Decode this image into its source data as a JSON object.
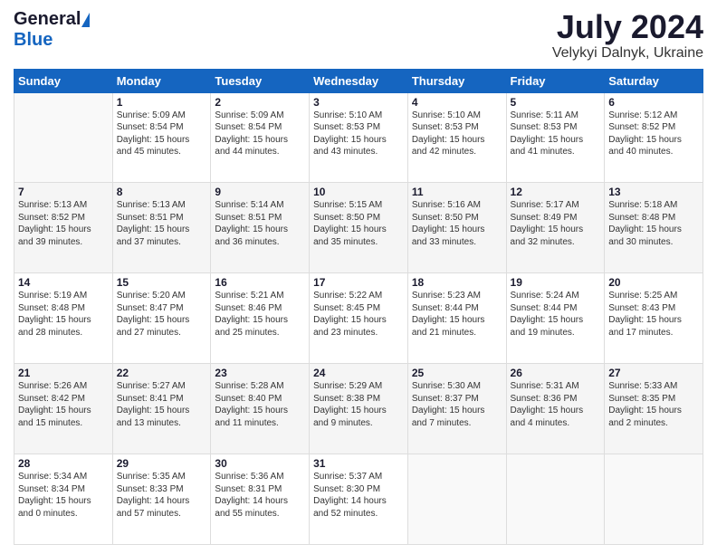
{
  "header": {
    "logo_general": "General",
    "logo_blue": "Blue",
    "month_title": "July 2024",
    "subtitle": "Velykyi Dalnyk, Ukraine"
  },
  "days_of_week": [
    "Sunday",
    "Monday",
    "Tuesday",
    "Wednesday",
    "Thursday",
    "Friday",
    "Saturday"
  ],
  "weeks": [
    [
      {
        "day": "",
        "lines": []
      },
      {
        "day": "1",
        "lines": [
          "Sunrise: 5:09 AM",
          "Sunset: 8:54 PM",
          "Daylight: 15 hours",
          "and 45 minutes."
        ]
      },
      {
        "day": "2",
        "lines": [
          "Sunrise: 5:09 AM",
          "Sunset: 8:54 PM",
          "Daylight: 15 hours",
          "and 44 minutes."
        ]
      },
      {
        "day": "3",
        "lines": [
          "Sunrise: 5:10 AM",
          "Sunset: 8:53 PM",
          "Daylight: 15 hours",
          "and 43 minutes."
        ]
      },
      {
        "day": "4",
        "lines": [
          "Sunrise: 5:10 AM",
          "Sunset: 8:53 PM",
          "Daylight: 15 hours",
          "and 42 minutes."
        ]
      },
      {
        "day": "5",
        "lines": [
          "Sunrise: 5:11 AM",
          "Sunset: 8:53 PM",
          "Daylight: 15 hours",
          "and 41 minutes."
        ]
      },
      {
        "day": "6",
        "lines": [
          "Sunrise: 5:12 AM",
          "Sunset: 8:52 PM",
          "Daylight: 15 hours",
          "and 40 minutes."
        ]
      }
    ],
    [
      {
        "day": "7",
        "lines": [
          "Sunrise: 5:13 AM",
          "Sunset: 8:52 PM",
          "Daylight: 15 hours",
          "and 39 minutes."
        ]
      },
      {
        "day": "8",
        "lines": [
          "Sunrise: 5:13 AM",
          "Sunset: 8:51 PM",
          "Daylight: 15 hours",
          "and 37 minutes."
        ]
      },
      {
        "day": "9",
        "lines": [
          "Sunrise: 5:14 AM",
          "Sunset: 8:51 PM",
          "Daylight: 15 hours",
          "and 36 minutes."
        ]
      },
      {
        "day": "10",
        "lines": [
          "Sunrise: 5:15 AM",
          "Sunset: 8:50 PM",
          "Daylight: 15 hours",
          "and 35 minutes."
        ]
      },
      {
        "day": "11",
        "lines": [
          "Sunrise: 5:16 AM",
          "Sunset: 8:50 PM",
          "Daylight: 15 hours",
          "and 33 minutes."
        ]
      },
      {
        "day": "12",
        "lines": [
          "Sunrise: 5:17 AM",
          "Sunset: 8:49 PM",
          "Daylight: 15 hours",
          "and 32 minutes."
        ]
      },
      {
        "day": "13",
        "lines": [
          "Sunrise: 5:18 AM",
          "Sunset: 8:48 PM",
          "Daylight: 15 hours",
          "and 30 minutes."
        ]
      }
    ],
    [
      {
        "day": "14",
        "lines": [
          "Sunrise: 5:19 AM",
          "Sunset: 8:48 PM",
          "Daylight: 15 hours",
          "and 28 minutes."
        ]
      },
      {
        "day": "15",
        "lines": [
          "Sunrise: 5:20 AM",
          "Sunset: 8:47 PM",
          "Daylight: 15 hours",
          "and 27 minutes."
        ]
      },
      {
        "day": "16",
        "lines": [
          "Sunrise: 5:21 AM",
          "Sunset: 8:46 PM",
          "Daylight: 15 hours",
          "and 25 minutes."
        ]
      },
      {
        "day": "17",
        "lines": [
          "Sunrise: 5:22 AM",
          "Sunset: 8:45 PM",
          "Daylight: 15 hours",
          "and 23 minutes."
        ]
      },
      {
        "day": "18",
        "lines": [
          "Sunrise: 5:23 AM",
          "Sunset: 8:44 PM",
          "Daylight: 15 hours",
          "and 21 minutes."
        ]
      },
      {
        "day": "19",
        "lines": [
          "Sunrise: 5:24 AM",
          "Sunset: 8:44 PM",
          "Daylight: 15 hours",
          "and 19 minutes."
        ]
      },
      {
        "day": "20",
        "lines": [
          "Sunrise: 5:25 AM",
          "Sunset: 8:43 PM",
          "Daylight: 15 hours",
          "and 17 minutes."
        ]
      }
    ],
    [
      {
        "day": "21",
        "lines": [
          "Sunrise: 5:26 AM",
          "Sunset: 8:42 PM",
          "Daylight: 15 hours",
          "and 15 minutes."
        ]
      },
      {
        "day": "22",
        "lines": [
          "Sunrise: 5:27 AM",
          "Sunset: 8:41 PM",
          "Daylight: 15 hours",
          "and 13 minutes."
        ]
      },
      {
        "day": "23",
        "lines": [
          "Sunrise: 5:28 AM",
          "Sunset: 8:40 PM",
          "Daylight: 15 hours",
          "and 11 minutes."
        ]
      },
      {
        "day": "24",
        "lines": [
          "Sunrise: 5:29 AM",
          "Sunset: 8:38 PM",
          "Daylight: 15 hours",
          "and 9 minutes."
        ]
      },
      {
        "day": "25",
        "lines": [
          "Sunrise: 5:30 AM",
          "Sunset: 8:37 PM",
          "Daylight: 15 hours",
          "and 7 minutes."
        ]
      },
      {
        "day": "26",
        "lines": [
          "Sunrise: 5:31 AM",
          "Sunset: 8:36 PM",
          "Daylight: 15 hours",
          "and 4 minutes."
        ]
      },
      {
        "day": "27",
        "lines": [
          "Sunrise: 5:33 AM",
          "Sunset: 8:35 PM",
          "Daylight: 15 hours",
          "and 2 minutes."
        ]
      }
    ],
    [
      {
        "day": "28",
        "lines": [
          "Sunrise: 5:34 AM",
          "Sunset: 8:34 PM",
          "Daylight: 15 hours",
          "and 0 minutes."
        ]
      },
      {
        "day": "29",
        "lines": [
          "Sunrise: 5:35 AM",
          "Sunset: 8:33 PM",
          "Daylight: 14 hours",
          "and 57 minutes."
        ]
      },
      {
        "day": "30",
        "lines": [
          "Sunrise: 5:36 AM",
          "Sunset: 8:31 PM",
          "Daylight: 14 hours",
          "and 55 minutes."
        ]
      },
      {
        "day": "31",
        "lines": [
          "Sunrise: 5:37 AM",
          "Sunset: 8:30 PM",
          "Daylight: 14 hours",
          "and 52 minutes."
        ]
      },
      {
        "day": "",
        "lines": []
      },
      {
        "day": "",
        "lines": []
      },
      {
        "day": "",
        "lines": []
      }
    ]
  ]
}
